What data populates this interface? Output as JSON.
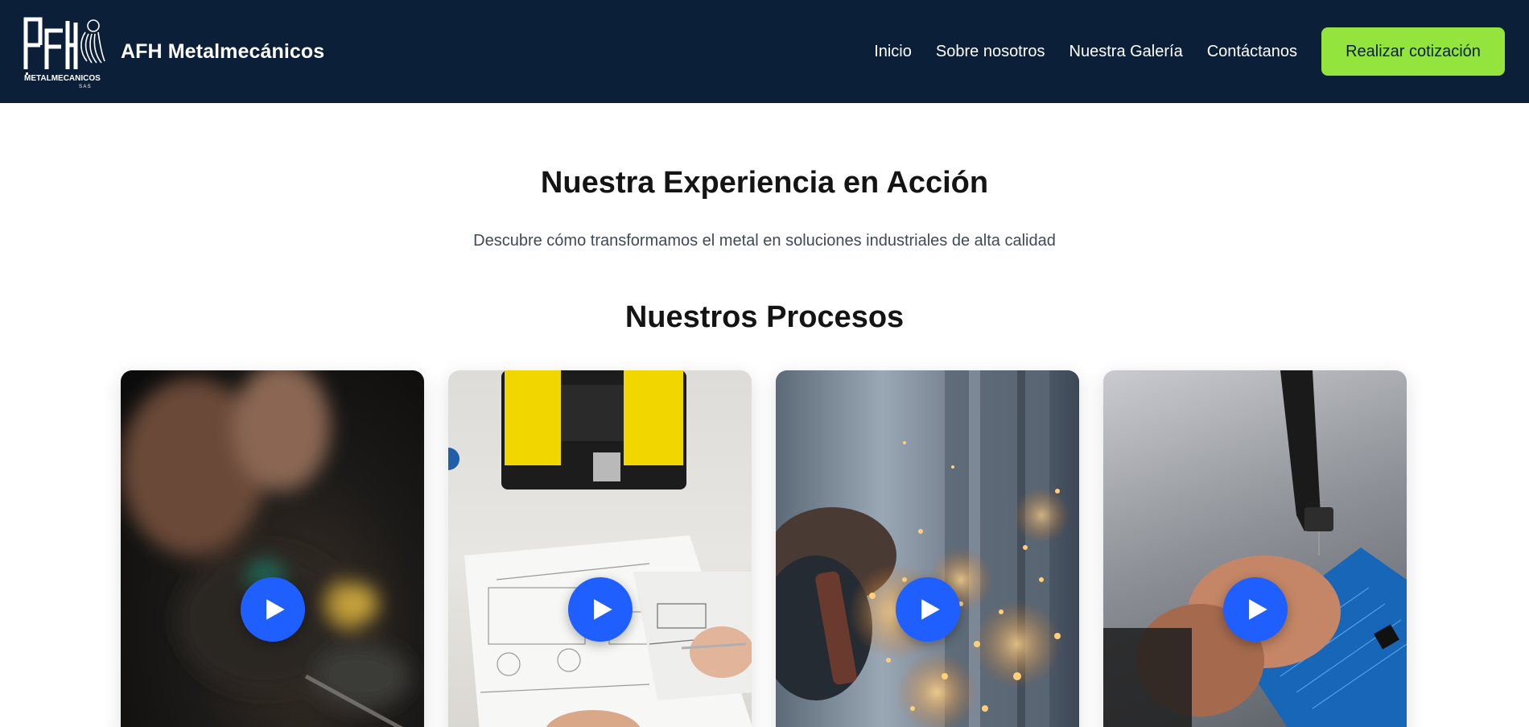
{
  "header": {
    "logo_text": "AFH METALMECANICOS SAS",
    "brand_name": "AFH Metalmecánicos",
    "nav": [
      {
        "label": "Inicio"
      },
      {
        "label": "Sobre nosotros"
      },
      {
        "label": "Nuestra Galería"
      },
      {
        "label": "Contáctanos"
      }
    ],
    "cta_label": "Realizar cotización"
  },
  "hero": {
    "title": "Nuestra Experiencia en Acción",
    "subtitle": "Descubre cómo transformamos el metal en soluciones industriales de alta calidad"
  },
  "processes": {
    "title": "Nuestros Procesos",
    "cards": [
      {
        "image": "electronics-soldering"
      },
      {
        "image": "technical-drawing-toolbox"
      },
      {
        "image": "metal-grinding-sparks"
      },
      {
        "image": "circuit-board-assembly"
      }
    ]
  },
  "colors": {
    "header_bg": "#0b1f38",
    "cta_bg": "#93e43c",
    "play_button": "#1f5fff"
  }
}
